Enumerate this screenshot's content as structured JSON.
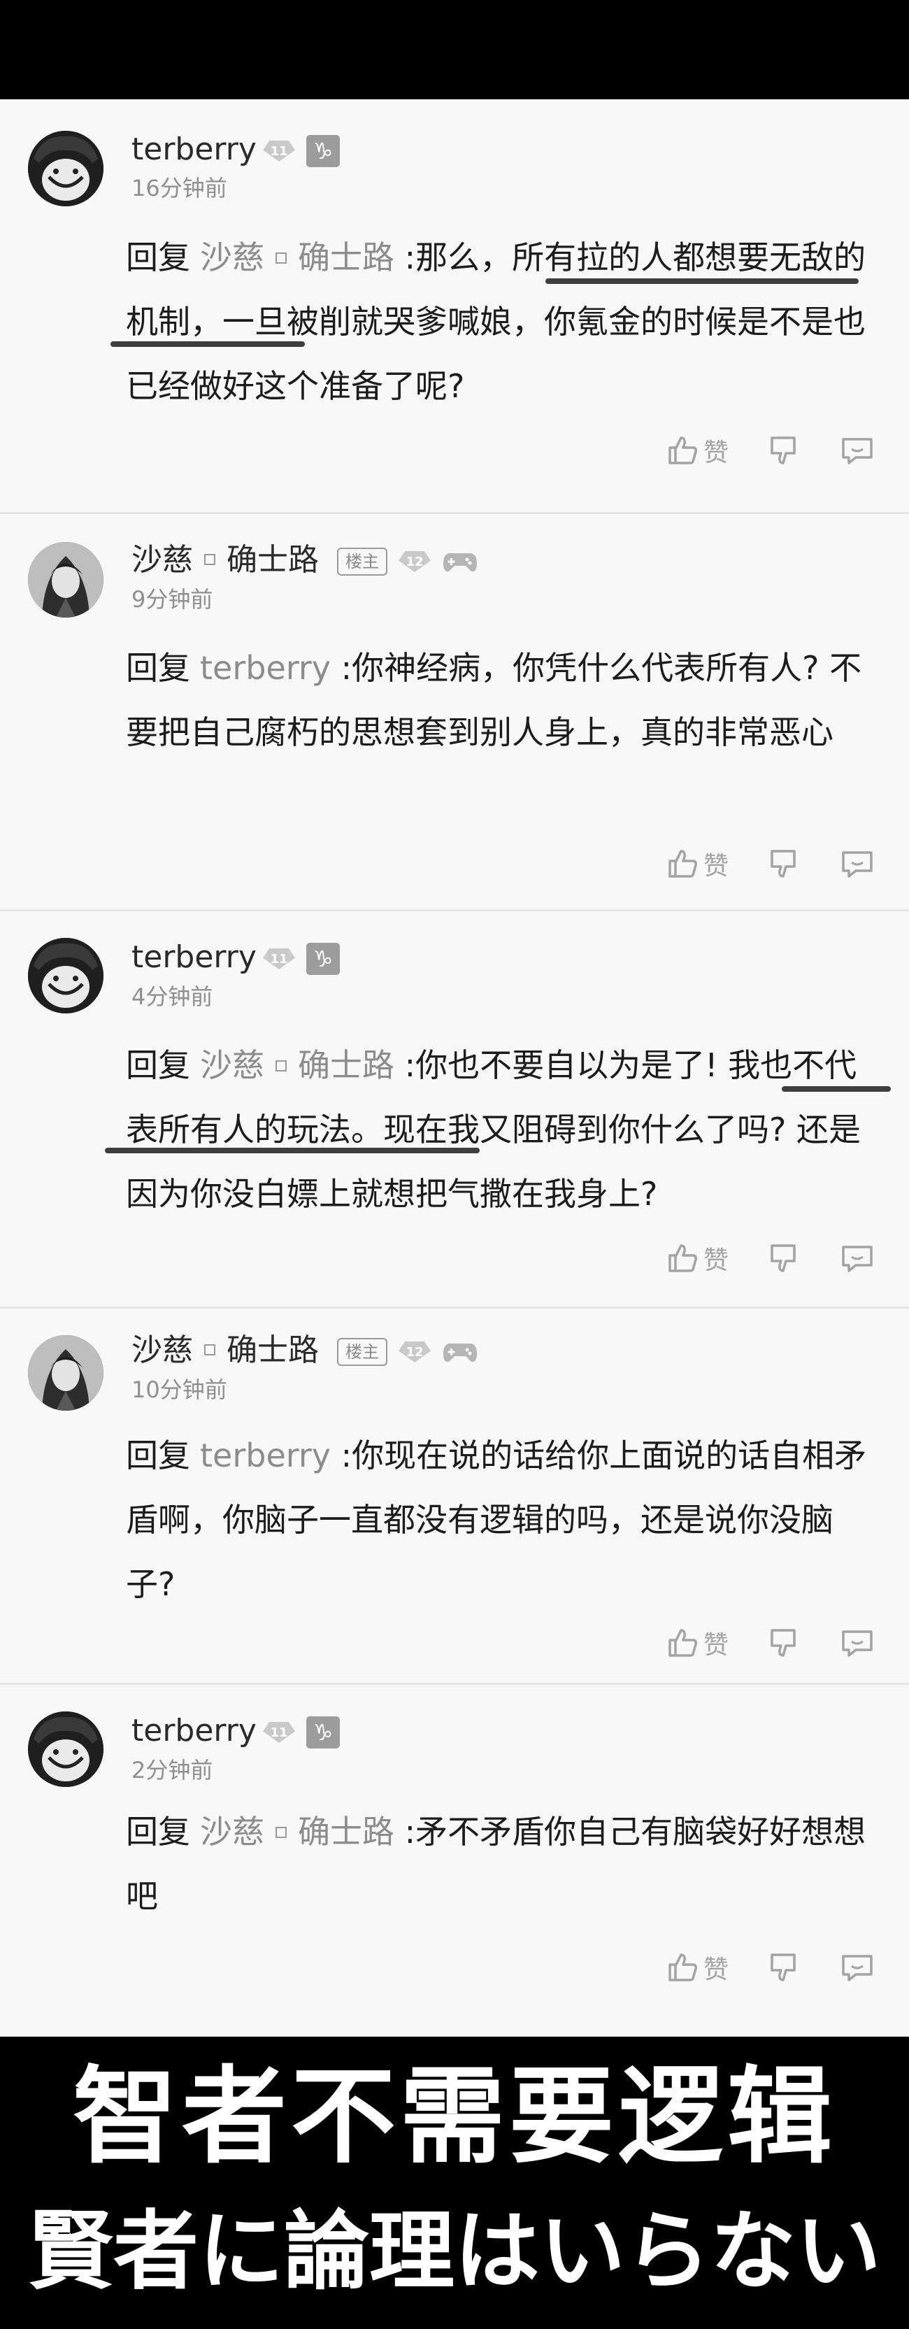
{
  "comments": [
    {
      "username": "terberry",
      "level": "11",
      "zodiac": "♑",
      "time": "16分钟前",
      "reply_word": "回复",
      "mention_name": "沙慈",
      "mention_rest": "确士路",
      "text": " :那么，所有拉的人都想要无敌的机制，一旦被削就哭爹喊娘，你氪金的时候是不是也已经做好这个准备了呢?",
      "like_label": "赞"
    },
    {
      "username": "沙慈",
      "username_rest": "确士路",
      "owner_tag": "楼主",
      "level": "12",
      "time": "9分钟前",
      "reply_word": "回复",
      "mention_name": "terberry",
      "text": " :你神经病，你凭什么代表所有人? 不要把自己腐朽的思想套到别人身上，真的非常恶心",
      "like_label": "赞"
    },
    {
      "username": "terberry",
      "level": "11",
      "zodiac": "♑",
      "time": "4分钟前",
      "reply_word": "回复",
      "mention_name": "沙慈",
      "mention_rest": "确士路",
      "text": " :你也不要自以为是了! 我也不代表所有人的玩法。现在我又阻碍到你什么了吗? 还是因为你没白嫖上就想把气撒在我身上?",
      "like_label": "赞"
    },
    {
      "username": "沙慈",
      "username_rest": "确士路",
      "owner_tag": "楼主",
      "level": "12",
      "time": "10分钟前",
      "reply_word": "回复",
      "mention_name": "terberry",
      "text": " :你现在说的话给你上面说的话自相矛盾啊，你脑子一直都没有逻辑的吗，还是说你没脑子?",
      "like_label": "赞"
    },
    {
      "username": "terberry",
      "level": "11",
      "zodiac": "♑",
      "time": "2分钟前",
      "reply_word": "回复",
      "mention_name": "沙慈",
      "mention_rest": "确士路",
      "text": " :矛不矛盾你自己有脑袋好好想想吧",
      "like_label": "赞"
    }
  ],
  "banner": {
    "chinese": "智者不需要逻辑",
    "japanese": "賢者に論理はいらない"
  },
  "icons": {
    "like": "thumbs-up-icon",
    "dislike": "thumbs-down-icon",
    "reply": "comment-bubble-icon",
    "gamepad": "gamepad-icon"
  }
}
